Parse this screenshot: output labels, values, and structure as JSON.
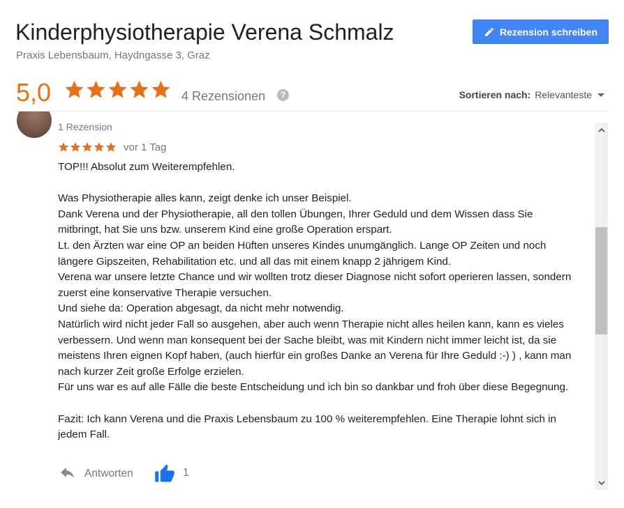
{
  "header": {
    "title": "Kinderphysiotherapie Verena Schmalz",
    "address": "Praxis Lebensbaum, Haydngasse 3, Graz",
    "write_review_label": "Rezension schreiben"
  },
  "summary": {
    "rating": "5,0",
    "stars": 5,
    "review_count_label": "4 Rezensionen",
    "help_glyph": "?"
  },
  "sort": {
    "label": "Sortieren nach:",
    "value": "Relevanteste"
  },
  "review": {
    "author_meta": "1 Rezension",
    "stars": 5,
    "date": "vor 1 Tag",
    "text": "TOP!!! Absolut zum Weiterempfehlen.\n\nWas Physiotherapie alles kann, zeigt denke ich unser Beispiel.\nDank Verena und der Physiotherapie, all den tollen Übungen, Ihrer Geduld und dem Wissen dass Sie mitbringt, hat Sie uns bzw. unserem Kind eine große Operation erspart.\nLt. den Ärzten war eine OP an beiden Hüften unseres Kindes unumgänglich. Lange OP Zeiten und noch längere Gipszeiten, Rehabilitation etc. und all das mit einem knapp 2 jährigem Kind.\nVerena war unsere letzte Chance und wir wollten trotz dieser Diagnose nicht sofort operieren lassen, sondern zuerst eine konservative Therapie versuchen.\nUnd siehe da: Operation abgesagt, da nicht mehr notwendig.\nNatürlich wird nicht jeder Fall so ausgehen, aber auch wenn Therapie nicht alles heilen kann, kann es vieles verbessern. Und wenn man konsequent bei der Sache bleibt, was mit Kindern nicht immer leicht ist, da sie meistens Ihren eignen Kopf haben, (auch hierfür ein großes Danke an Verena für Ihre Geduld :-) ) , kann man nach kurzer Zeit große Erfolge erzielen.\nFür uns war es auf alle Fälle die beste Entscheidung und ich bin so dankbar und froh über diese Begegnung.\n\nFazit: Ich kann Verena und die Praxis Lebensbaum zu 100 % weiterempfehlen. Eine Therapie lohnt sich in jedem Fall.",
    "reply_label": "Antworten",
    "like_count": "1"
  },
  "colors": {
    "accent_blue": "#4285f4",
    "star_orange": "#e7711b",
    "muted_text": "#777777"
  },
  "icons": [
    "pencil-icon",
    "star-icon",
    "help-icon",
    "reply-arrow-icon",
    "thumbs-up-icon",
    "chevron-up-icon",
    "chevron-down-icon"
  ]
}
